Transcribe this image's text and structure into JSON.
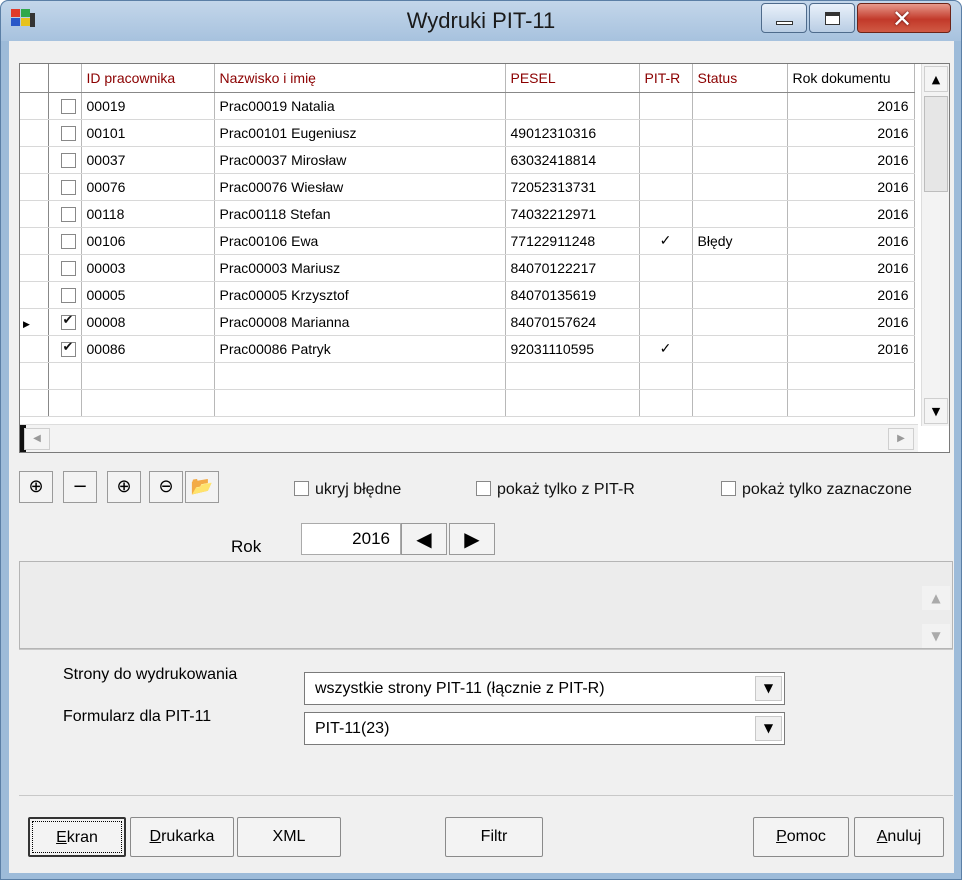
{
  "window": {
    "title": "Wydruki PIT-11",
    "close_icon": "close-icon",
    "minimize_icon": "minimize-icon",
    "maximize_icon": "maximize-icon"
  },
  "grid": {
    "columns": [
      "ID pracownika",
      "Nazwisko i imię",
      "PESEL",
      "PIT-R",
      "Status",
      "Rok dokumentu"
    ],
    "rows": [
      {
        "checked": false,
        "current": false,
        "id": "00019",
        "name": "Prac00019 Natalia",
        "pesel": "",
        "pitr": "",
        "status": "",
        "year": "2016"
      },
      {
        "checked": false,
        "current": false,
        "id": "00101",
        "name": "Prac00101 Eugeniusz",
        "pesel": "49012310316",
        "pitr": "",
        "status": "",
        "year": "2016"
      },
      {
        "checked": false,
        "current": false,
        "id": "00037",
        "name": "Prac00037 Mirosław",
        "pesel": "63032418814",
        "pitr": "",
        "status": "",
        "year": "2016"
      },
      {
        "checked": false,
        "current": false,
        "id": "00076",
        "name": "Prac00076 Wiesław",
        "pesel": "72052313731",
        "pitr": "",
        "status": "",
        "year": "2016"
      },
      {
        "checked": false,
        "current": false,
        "id": "00118",
        "name": "Prac00118 Stefan",
        "pesel": "74032212971",
        "pitr": "",
        "status": "",
        "year": "2016"
      },
      {
        "checked": false,
        "current": false,
        "id": "00106",
        "name": "Prac00106 Ewa",
        "pesel": "77122911248",
        "pitr": "✓",
        "status": "Błędy",
        "year": "2016"
      },
      {
        "checked": false,
        "current": false,
        "id": "00003",
        "name": "Prac00003 Mariusz",
        "pesel": "84070122217",
        "pitr": "",
        "status": "",
        "year": "2016"
      },
      {
        "checked": false,
        "current": false,
        "id": "00005",
        "name": "Prac00005 Krzysztof",
        "pesel": "84070135619",
        "pitr": "",
        "status": "",
        "year": "2016"
      },
      {
        "checked": true,
        "current": true,
        "id": "00008",
        "name": "Prac00008 Marianna",
        "pesel": "84070157624",
        "pitr": "",
        "status": "",
        "year": "2016"
      },
      {
        "checked": true,
        "current": false,
        "id": "00086",
        "name": "Prac00086 Patryk",
        "pesel": "92031110595",
        "pitr": "✓",
        "status": "",
        "year": "2016"
      }
    ]
  },
  "toolbar": {
    "icons": [
      "add-icon",
      "remove-icon",
      "add-all-icon",
      "remove-all-icon",
      "open-folder-icon"
    ],
    "glyphs": [
      "⊕",
      "−",
      "⊕",
      "⊖",
      "📂"
    ]
  },
  "options": {
    "hide_errors": "ukryj błędne",
    "only_pitr": "pokaż tylko z PIT-R",
    "only_checked": "pokaż tylko zaznaczone"
  },
  "year": {
    "label": "Rok",
    "value": "2016"
  },
  "settings": {
    "pages_label": "Strony do wydrukowania",
    "pages_value": "wszystkie strony PIT-11 (łącznie z PIT-R)",
    "form_label": "Formularz dla PIT-11",
    "form_value": "PIT-11(23)"
  },
  "buttons": {
    "screen": {
      "first": "E",
      "rest": "kran"
    },
    "printer": {
      "first": "D",
      "rest": "rukarka"
    },
    "xml": "XML",
    "filter": "Filtr",
    "help": {
      "first": "P",
      "rest": "omoc"
    },
    "cancel": {
      "first": "A",
      "rest": "nuluj"
    }
  },
  "colors": {
    "header_text": "#8b0000",
    "title_bar": "#a7c2de",
    "close_button": "#c2392a"
  }
}
